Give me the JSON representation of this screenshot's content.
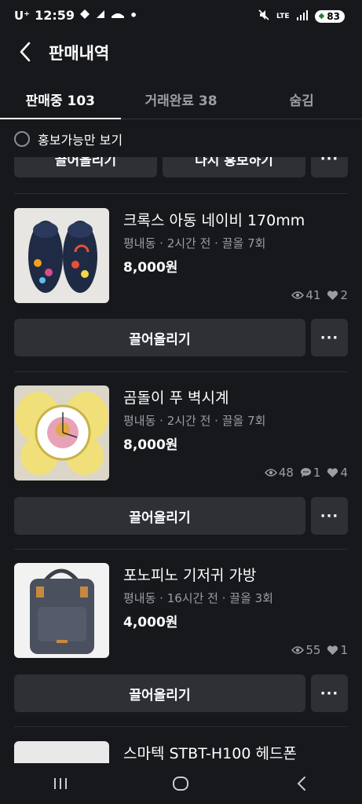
{
  "status": {
    "carrier": "U⁺",
    "time": "12:59",
    "dot": "•",
    "network": "LTE",
    "battery": "83"
  },
  "header": {
    "title": "판매내역"
  },
  "tabs": [
    {
      "label": "판매중 103",
      "active": true
    },
    {
      "label": "거래완료 38",
      "active": false
    },
    {
      "label": "숨김",
      "active": false
    }
  ],
  "filter": {
    "label": "홍보가능만 보기"
  },
  "partial_row": {
    "bump_label": "끌어올리기",
    "promote_label": "다시 홍보하기",
    "more": "···"
  },
  "items": [
    {
      "title": "크록스 아동 네이비 170mm",
      "meta": "평내동 · 2시간 전 · 끌올 7회",
      "price": "8,000원",
      "views": "41",
      "likes": "2",
      "bump_label": "끌어올리기",
      "more": "···"
    },
    {
      "title": "곰돌이 푸 벽시계",
      "meta": "평내동 · 2시간 전 · 끌올 7회",
      "price": "8,000원",
      "views": "48",
      "chats": "1",
      "likes": "4",
      "bump_label": "끌어올리기",
      "more": "···"
    },
    {
      "title": "포노피노 기저귀 가방",
      "meta": "평내동 · 16시간 전 · 끌올 3회",
      "price": "4,000원",
      "views": "55",
      "likes": "1",
      "bump_label": "끌어올리기",
      "more": "···"
    },
    {
      "title": "스마텍 STBT-H100  헤드폰"
    }
  ],
  "icons": {
    "back": "chevron-left-icon",
    "views": "eye-icon",
    "chats": "chat-bubble-icon",
    "likes": "heart-icon",
    "nav_recent": "recent-apps-icon",
    "nav_home": "home-icon",
    "nav_back": "back-icon"
  },
  "colors": {
    "background": "#17181c",
    "button": "#2e3036",
    "muted": "#9a9da5"
  }
}
